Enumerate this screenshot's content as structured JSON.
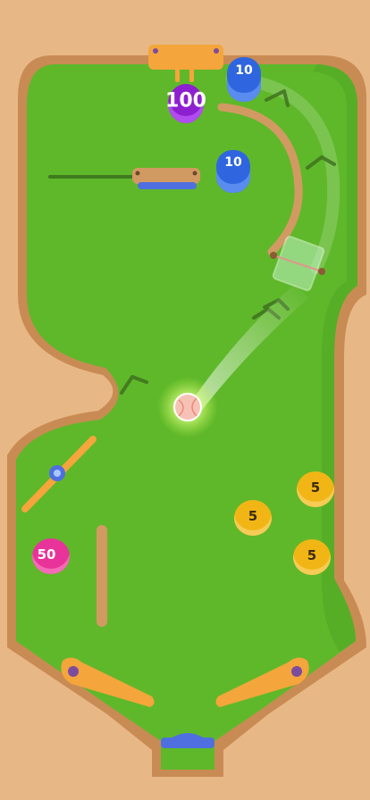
{
  "targets": {
    "jackpot": {
      "value": "100",
      "color": "#8e1fd0"
    },
    "blue_top": {
      "value": "10",
      "color": "#2f66e0"
    },
    "blue_mid": {
      "value": "10",
      "color": "#2f66e0"
    },
    "pink": {
      "value": "50",
      "color": "#e8349a"
    },
    "gold_1": {
      "value": "5",
      "color": "#f1b616"
    },
    "gold_2": {
      "value": "5",
      "color": "#f1b616"
    },
    "gold_3": {
      "value": "5",
      "color": "#f1b616"
    }
  },
  "colors": {
    "table_green": "#5fb82a",
    "rail_wood": "#d29a63",
    "flipper_orange": "#f4a53b",
    "background_sand": "#e7b886",
    "ball": "#f7c2b6",
    "drain_blue": "#4f6fe0"
  },
  "icons": [
    "bumper-coin-icon",
    "pinball-ball-icon",
    "flipper-icon",
    "spinner-icon",
    "arrow-chevron-icon"
  ]
}
